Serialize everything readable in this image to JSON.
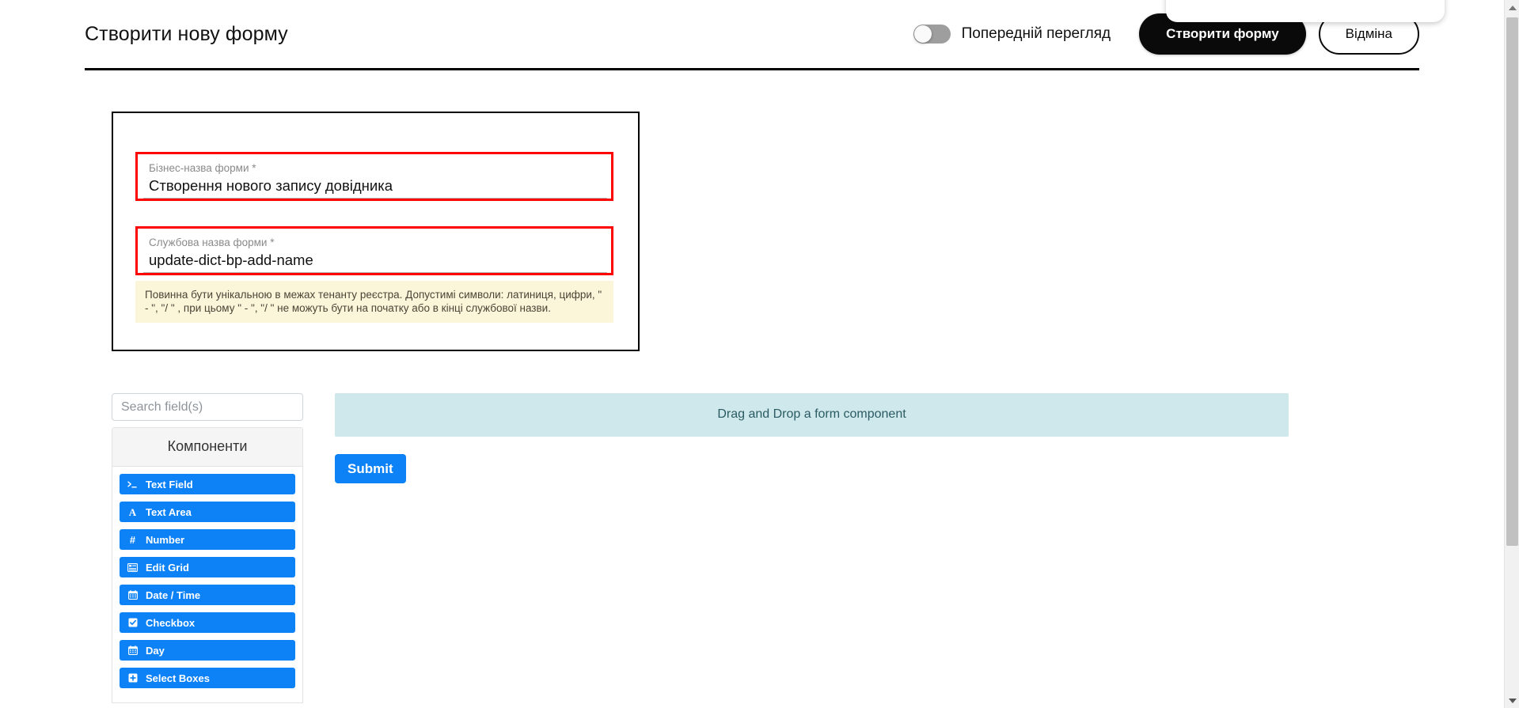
{
  "header": {
    "title": "Створити нову форму",
    "preview_toggle": {
      "label": "Попередній перегляд",
      "state": "off"
    },
    "create_button": "Створити форму",
    "cancel_button": "Відміна"
  },
  "settings": {
    "business_name": {
      "label": "Бізнес-назва форми *",
      "value": "Створення нового запису довідника"
    },
    "service_name": {
      "label": "Службова назва форми *",
      "value": "update-dict-bp-add-name"
    },
    "hint": "Повинна бути унікальною в межах тенанту реєстра. Допустимі символи: латиниця, цифри, \" - \", \"/ \" , при цьому  \" - \", \"/ \" не можуть бути на початку або в кінці службової назви."
  },
  "builder": {
    "search_placeholder": "Search field(s)",
    "search_value": "",
    "panel_title": "Компоненти",
    "components": [
      {
        "label": "Text Field",
        "icon": "terminal-icon"
      },
      {
        "label": "Text Area",
        "icon": "text-a-icon"
      },
      {
        "label": "Number",
        "icon": "hash-icon"
      },
      {
        "label": "Edit Grid",
        "icon": "grid-list-icon"
      },
      {
        "label": "Date / Time",
        "icon": "calendar-icon"
      },
      {
        "label": "Checkbox",
        "icon": "checkbox-icon"
      },
      {
        "label": "Day",
        "icon": "calendar-icon"
      },
      {
        "label": "Select Boxes",
        "icon": "plus-square-icon"
      }
    ],
    "dropzone_text": "Drag and Drop a form component",
    "submit_label": "Submit"
  },
  "colors": {
    "accent_blue": "#0d82f7",
    "dropzone_bg": "#cfe8ec",
    "hint_bg": "#fbf6d9",
    "highlight_border": "#ff0000",
    "primary_dark": "#0a0a0a"
  }
}
